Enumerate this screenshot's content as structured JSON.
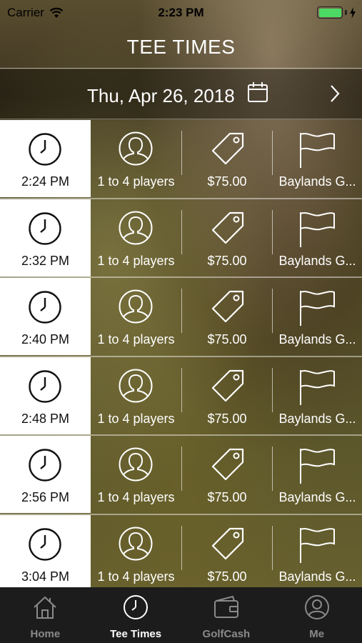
{
  "status_bar": {
    "carrier": "Carrier",
    "time": "2:23 PM"
  },
  "header": {
    "title": "TEE TIMES"
  },
  "date_bar": {
    "date": "Thu, Apr 26, 2018"
  },
  "tee_times": [
    {
      "time": "2:24 PM",
      "players": "1 to 4 players",
      "price": "$75.00",
      "course": "Baylands G..."
    },
    {
      "time": "2:32 PM",
      "players": "1 to 4 players",
      "price": "$75.00",
      "course": "Baylands G..."
    },
    {
      "time": "2:40 PM",
      "players": "1 to 4 players",
      "price": "$75.00",
      "course": "Baylands G..."
    },
    {
      "time": "2:48 PM",
      "players": "1 to 4 players",
      "price": "$75.00",
      "course": "Baylands G..."
    },
    {
      "time": "2:56 PM",
      "players": "1 to 4 players",
      "price": "$75.00",
      "course": "Baylands G..."
    },
    {
      "time": "3:04 PM",
      "players": "1 to 4 players",
      "price": "$75.00",
      "course": "Baylands G..."
    }
  ],
  "tabs": [
    {
      "label": "Home",
      "icon": "home-icon",
      "active": false
    },
    {
      "label": "Tee Times",
      "icon": "clock-icon",
      "active": true
    },
    {
      "label": "GolfCash",
      "icon": "wallet-icon",
      "active": false
    },
    {
      "label": "Me",
      "icon": "user-icon",
      "active": false
    }
  ],
  "colors": {
    "battery": "#4cd964",
    "tabbar_bg": "#1c1c1c",
    "active_tab": "#ffffff",
    "inactive_tab": "#8a8a8a"
  }
}
